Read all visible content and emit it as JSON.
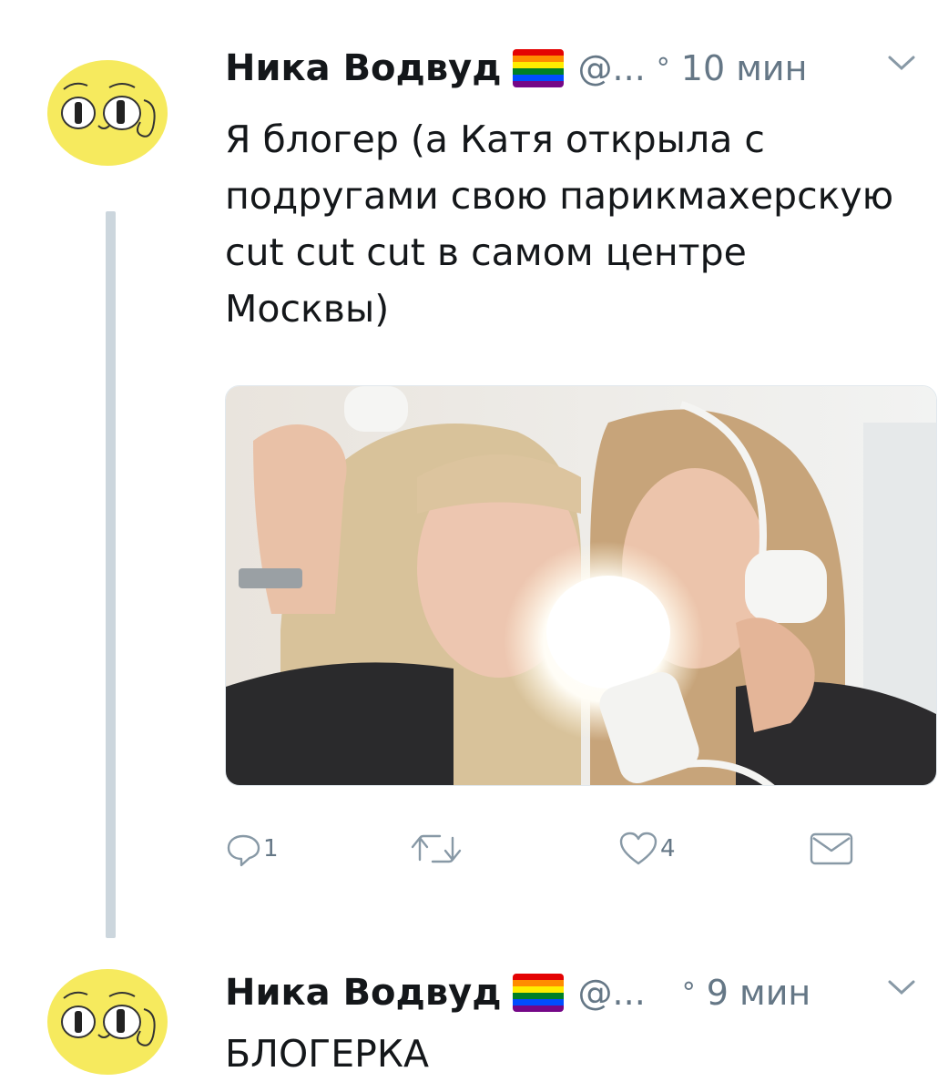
{
  "tweets": [
    {
      "author_name": "Ника Водвуд",
      "flag_icon": "rainbow-flag-icon",
      "handle": "@...",
      "separator": "°",
      "time": "10 мин",
      "text": "Я блогер (а Катя открыла с подругами свою парикмахерскую cut cut cut в самом центре Москвы)",
      "media_icon": "photo-image",
      "actions": {
        "reply_count": "1",
        "retweet_count": "",
        "like_count": "4"
      }
    },
    {
      "author_name": "Ника Водвуд",
      "flag_icon": "rainbow-flag-icon",
      "handle": "@...",
      "separator": "°",
      "time": "9 мин",
      "text": "БЛОГЕРКА"
    }
  ],
  "colors": {
    "avatar_yellow": "#f6ea5e",
    "secondary_text": "#657786",
    "thread_line": "#ccd6dd",
    "rainbow": [
      "#e40303",
      "#ff8c00",
      "#ffed00",
      "#008026",
      "#004dff",
      "#750787"
    ]
  }
}
